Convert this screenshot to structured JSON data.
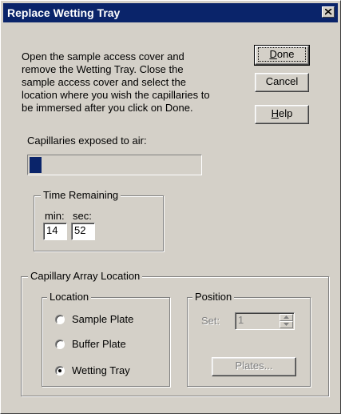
{
  "window": {
    "title": "Replace Wetting Tray"
  },
  "message": {
    "lines": [
      "Open the sample access cover and",
      "remove the Wetting Tray. Close the",
      "sample access cover and select the",
      "location where you wish the capillaries to",
      "be immersed after you click on Done."
    ]
  },
  "buttons": {
    "done": {
      "mnemonic": "D",
      "rest": "one"
    },
    "cancel": {
      "label": "Cancel"
    },
    "help": {
      "mnemonic": "H",
      "rest": "elp"
    },
    "plates": {
      "label": "Plates..."
    }
  },
  "progress": {
    "label": "Capillaries exposed to air:",
    "fraction": 0.07,
    "color": "#0a246a"
  },
  "time_remaining": {
    "legend": "Time Remaining",
    "min_label": "min:",
    "sec_label": "sec:",
    "min_value": "14",
    "sec_value": "52"
  },
  "array_location": {
    "legend": "Capillary Array Location",
    "location": {
      "legend": "Location",
      "options": [
        {
          "label": "Sample Plate",
          "selected": false
        },
        {
          "label": "Buffer Plate",
          "selected": false
        },
        {
          "label": "Wetting Tray",
          "selected": true
        }
      ]
    },
    "position": {
      "legend": "Position",
      "set_label": "Set:",
      "set_value": "1"
    }
  },
  "colors": {
    "titlebar": "#0a246a",
    "face": "#d4d0c8"
  },
  "icons": {
    "close": "close-icon",
    "spin_up": "arrow-up-icon",
    "spin_down": "arrow-down-icon"
  }
}
